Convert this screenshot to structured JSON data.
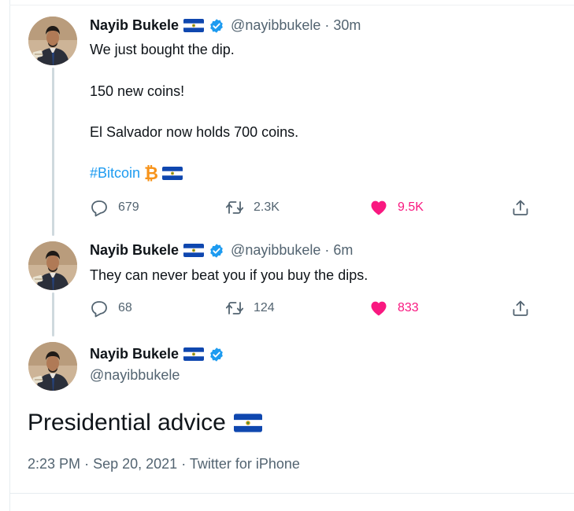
{
  "colors": {
    "accent": "#1d9bf0",
    "like": "#f91880",
    "muted": "#536471",
    "text": "#0f1419"
  },
  "tweets": [
    {
      "author": {
        "name": "Nayib Bukele",
        "handle": "@nayibbukele",
        "flag_icon": "el-salvador-flag-icon",
        "verified_icon": "verified-badge-icon"
      },
      "time": "30m",
      "lines": [
        "We just bought the dip.",
        "150 new coins!",
        "El Salvador now holds 700 coins."
      ],
      "hashtag": "#Bitcoin",
      "hashtag_icons": [
        "bitcoin-icon",
        "el-salvador-flag-icon"
      ],
      "replies": "679",
      "retweets": "2.3K",
      "likes": "9.5K"
    },
    {
      "author": {
        "name": "Nayib Bukele",
        "handle": "@nayibbukele",
        "flag_icon": "el-salvador-flag-icon",
        "verified_icon": "verified-badge-icon"
      },
      "time": "6m",
      "lines": [
        "They can never beat you if you buy the dips."
      ],
      "replies": "68",
      "retweets": "124",
      "likes": "833"
    }
  ],
  "main_tweet": {
    "author": {
      "name": "Nayib Bukele",
      "handle": "@nayibbukele"
    },
    "text": "Presidential advice",
    "time": "2:23 PM",
    "date": "Sep 20, 2021",
    "source": "Twitter for iPhone"
  }
}
